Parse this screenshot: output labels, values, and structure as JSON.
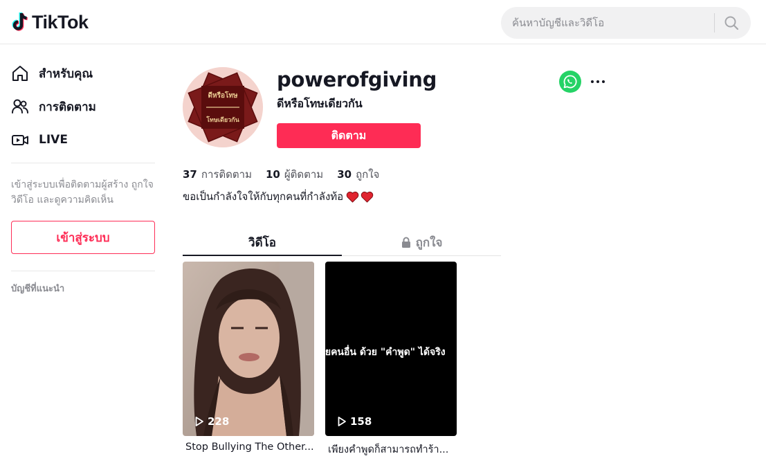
{
  "header": {
    "logo_text": "TikTok",
    "search_placeholder": "ค้นหาบัญชีและวิดีโอ"
  },
  "sidebar": {
    "items": [
      {
        "label": "สำหรับคุณ",
        "icon": "home-icon"
      },
      {
        "label": "การติดตาม",
        "icon": "following-icon"
      },
      {
        "label": "LIVE",
        "icon": "live-icon"
      }
    ],
    "login_hint": "เข้าสู่ระบบเพื่อติดตามผู้สร้าง ถูกใจวิดีโอ และดูความคิดเห็น",
    "login_button": "เข้าสู่ระบบ",
    "suggested_title": "บัญชีที่แนะนำ"
  },
  "profile": {
    "username": "powerofgiving",
    "nickname": "ดีหรือโทษเดียวกัน",
    "follow_button": "ติดตาม",
    "avatar_text_top": "ดีหรือโทษ",
    "avatar_text_bottom": "โทษเดียวกัน",
    "stats": [
      {
        "value": "37",
        "label": "การติดตาม"
      },
      {
        "value": "10",
        "label": "ผู้ติดตาม"
      },
      {
        "value": "30",
        "label": "ถูกใจ"
      }
    ],
    "bio": "ขอเป็นกำลังใจให้กับทุกคนที่กำลังท้อ"
  },
  "tabs": {
    "videos": "วิดีโอ",
    "liked": "ถูกใจ"
  },
  "videos": [
    {
      "views": "228",
      "caption": "Stop Bullying The Other..."
    },
    {
      "views": "158",
      "caption": "เพียงคำพูดก็สามารถทำร้า...",
      "overlay_text": "ายคนอื่น ด้วย \"คำพูด\" ได้จริง"
    }
  ],
  "colors": {
    "brand": "#fe2c55",
    "whatsapp": "#25d366",
    "text": "#161823",
    "muted": "#8a8b91"
  }
}
